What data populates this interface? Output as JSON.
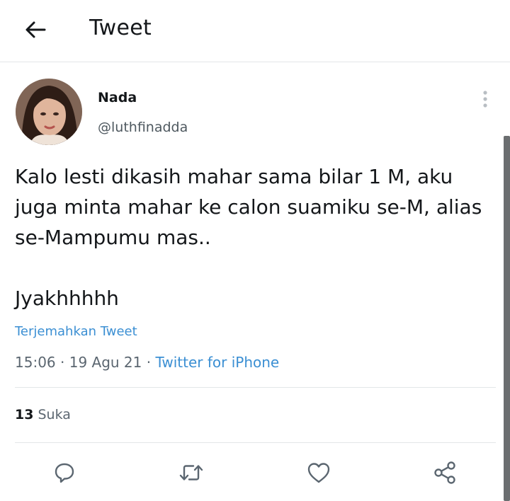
{
  "header": {
    "title": "Tweet",
    "back_icon": "arrow-left-icon"
  },
  "tweet": {
    "author": {
      "display_name": "Nada",
      "handle": "@luthfinadda"
    },
    "text": "Kalo lesti dikasih mahar sama bilar 1 M, aku\njuga minta mahar ke calon suamiku se-M, alias\nse-Mampumu mas..\n\nJyakhhhhh",
    "translate_label": "Terjemahkan Tweet",
    "time": "15:06",
    "date": "19 Agu 21",
    "separator": " · ",
    "source": "Twitter for iPhone",
    "likes_count": "13",
    "likes_label": "Suka"
  },
  "actions": {
    "reply_icon": "reply-icon",
    "retweet_icon": "retweet-icon",
    "like_icon": "heart-icon",
    "share_icon": "share-icon"
  },
  "colors": {
    "link": "#3b8fd3",
    "text": "#14171a",
    "secondary": "#5b6670",
    "divider": "#e3e6e8"
  }
}
